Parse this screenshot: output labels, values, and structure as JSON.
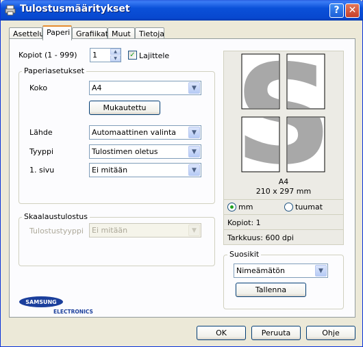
{
  "window": {
    "title": "Tulostusmääritykset",
    "help_button": "?",
    "close_button": "✕"
  },
  "tabs": [
    {
      "label": "Asettelu"
    },
    {
      "label": "Paperi"
    },
    {
      "label": "Grafiikat"
    },
    {
      "label": "Muut"
    },
    {
      "label": "Tietoja"
    }
  ],
  "copies": {
    "label": "Kopiot (1 - 999)",
    "value": "1",
    "collate_label": "Lajittele",
    "collate_checked": true
  },
  "paper_options": {
    "title": "Paperiasetukset",
    "size": {
      "label": "Koko",
      "value": "A4"
    },
    "custom_button": "Mukautettu",
    "source": {
      "label": "Lähde",
      "value": "Automaattinen valinta"
    },
    "type": {
      "label": "Tyyppi",
      "value": "Tulostimen oletus"
    },
    "first_page": {
      "label": "1. sivu",
      "value": "Ei mitään"
    }
  },
  "scaling": {
    "title": "Skaalaustulostus",
    "print_type": {
      "label": "Tulostustyyppi",
      "value": "Ei mitään"
    }
  },
  "preview": {
    "paper_name": "A4",
    "paper_dims": "210 x 297 mm",
    "unit_mm": "mm",
    "unit_inch": "tuumat",
    "selected_unit": "mm",
    "copies_text": "Kopiot: 1",
    "resolution_text": "Tarkkuus: 600 dpi",
    "glyph": "S"
  },
  "favorites": {
    "title": "Suosikit",
    "value": "Nimeämätön",
    "save_button": "Tallenna"
  },
  "logo": {
    "brand": "SAMSUNG",
    "sub": "ELECTRONICS"
  },
  "dialog_buttons": {
    "ok": "OK",
    "cancel": "Peruuta",
    "help": "Ohje"
  },
  "colors": {
    "titlebar": "#0a50d8",
    "dialog_bg": "#ece9d8",
    "panel_bg": "#fcfcfe",
    "preview_glyph": "#a8a8a8",
    "logo_blue": "#1b3f9c"
  }
}
